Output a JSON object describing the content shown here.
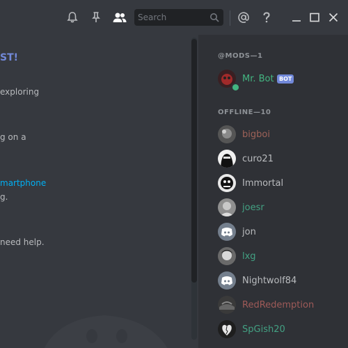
{
  "toolbar": {
    "search_placeholder": "Search",
    "icons": [
      "bell-icon",
      "pin-icon",
      "members-icon",
      "search-icon",
      "mention-icon",
      "help-icon",
      "minimize-icon",
      "maximize-icon",
      "close-icon"
    ]
  },
  "chat": {
    "lines": [
      {
        "text": "ST!",
        "style": "title"
      },
      {
        "text": "exploring",
        "style": "normal"
      },
      {
        "text": "g on a",
        "style": "normal"
      },
      {
        "text": "martphone",
        "style": "link"
      },
      {
        "text": "g.",
        "style": "normal"
      },
      {
        "text": "need help.",
        "style": "normal"
      }
    ]
  },
  "members": {
    "mods_header": "@MODS—1",
    "offline_header": "OFFLINE—10",
    "mods": [
      {
        "name": "Mr. Bot",
        "color": "#43b581",
        "badge": "BOT",
        "status": "online"
      }
    ],
    "offline": [
      {
        "name": "bigboi",
        "color": "#9e6258"
      },
      {
        "name": "curo21",
        "color": "#b9bbbe"
      },
      {
        "name": "Immortal",
        "color": "#b9bbbe"
      },
      {
        "name": "joesr",
        "color": "#43a183"
      },
      {
        "name": "jon",
        "color": "#b9bbbe"
      },
      {
        "name": "lxg",
        "color": "#43a183"
      },
      {
        "name": "Nightwolf84",
        "color": "#b9bbbe"
      },
      {
        "name": "RedRedemption",
        "color": "#9e5a58"
      },
      {
        "name": "SpGish20",
        "color": "#43a183"
      }
    ]
  }
}
